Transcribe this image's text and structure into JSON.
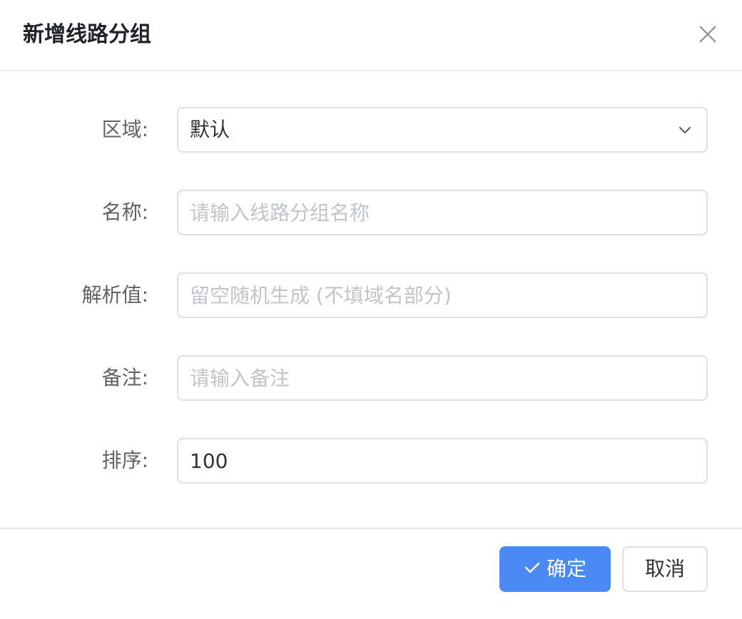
{
  "dialog": {
    "title": "新增线路分组"
  },
  "form": {
    "region": {
      "label": "区域:",
      "value": "默认"
    },
    "name": {
      "label": "名称:",
      "placeholder": "请输入线路分组名称",
      "value": ""
    },
    "resolve": {
      "label": "解析值:",
      "placeholder": "留空随机生成 (不填域名部分)",
      "value": ""
    },
    "remark": {
      "label": "备注:",
      "placeholder": "请输入备注",
      "value": ""
    },
    "sort": {
      "label": "排序:",
      "value": "100"
    }
  },
  "footer": {
    "confirm_label": "确定",
    "cancel_label": "取消"
  },
  "colors": {
    "primary": "#4a8af4",
    "border": "#dcdfe6",
    "placeholder": "#c0c4cc"
  },
  "icons": {
    "close": "close-icon",
    "chevron": "chevron-down-icon",
    "check": "check-icon"
  }
}
